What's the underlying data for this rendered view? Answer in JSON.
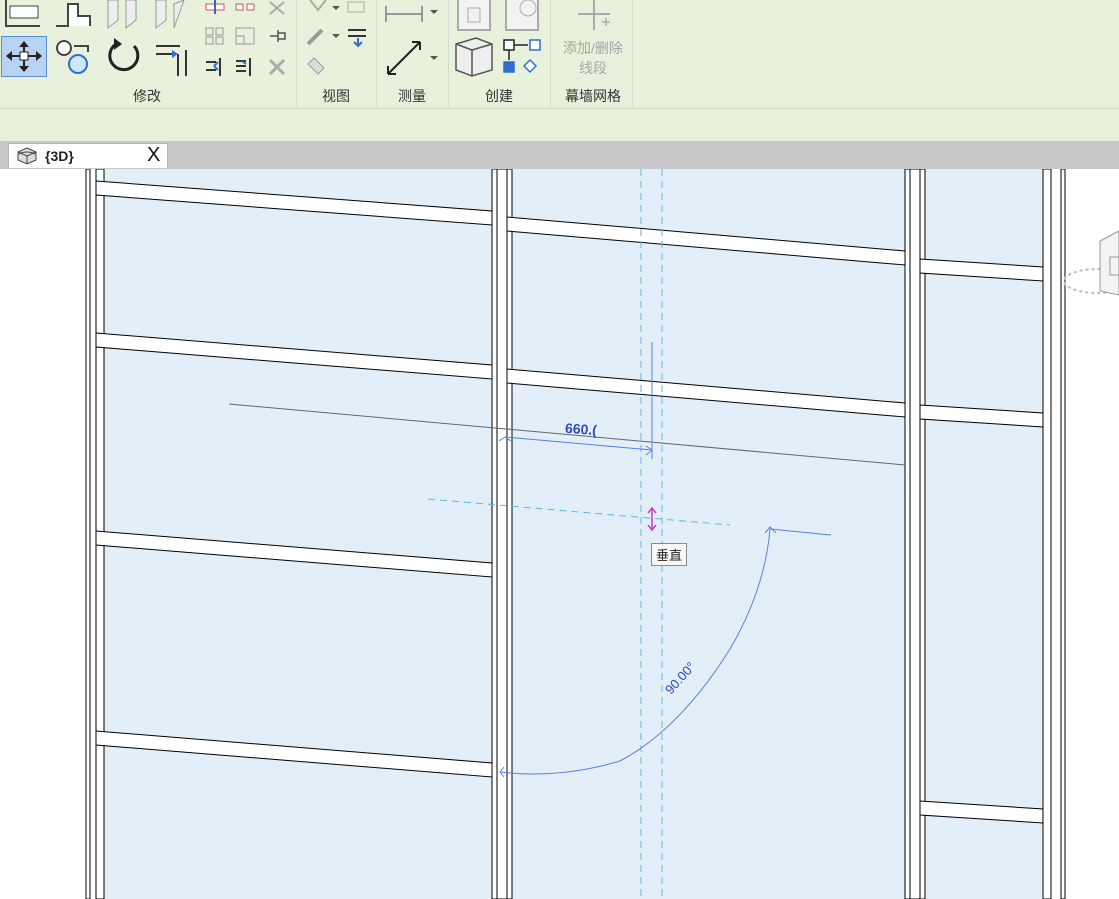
{
  "ribbon": {
    "panels": {
      "modify": "修改",
      "view": "视图",
      "measure": "测量",
      "create": "创建",
      "curtain_grid": "幕墙网格"
    },
    "add_delete_segment": "添加/删除\n线段",
    "add_delete_segment_line1": "添加/删除",
    "add_delete_segment_line2": "线段"
  },
  "tabs": [
    {
      "label": "{3D}",
      "icon": "3d-view-icon",
      "close": "X"
    }
  ],
  "viewport": {
    "dimension_label": "660.(",
    "angle_label": "90.00°",
    "tooltip": "垂直"
  },
  "colors": {
    "ribbon_bg": "#e8f1dc",
    "glass": "#e2eff9",
    "mullion": "#ffffff",
    "mullion_edge": "#000000",
    "guide_dash": "#5bb6e4",
    "measure_line": "#5b7fe0",
    "selected_tool_bg": "#b8d3f2",
    "cursor_magenta": "#c040c0"
  }
}
